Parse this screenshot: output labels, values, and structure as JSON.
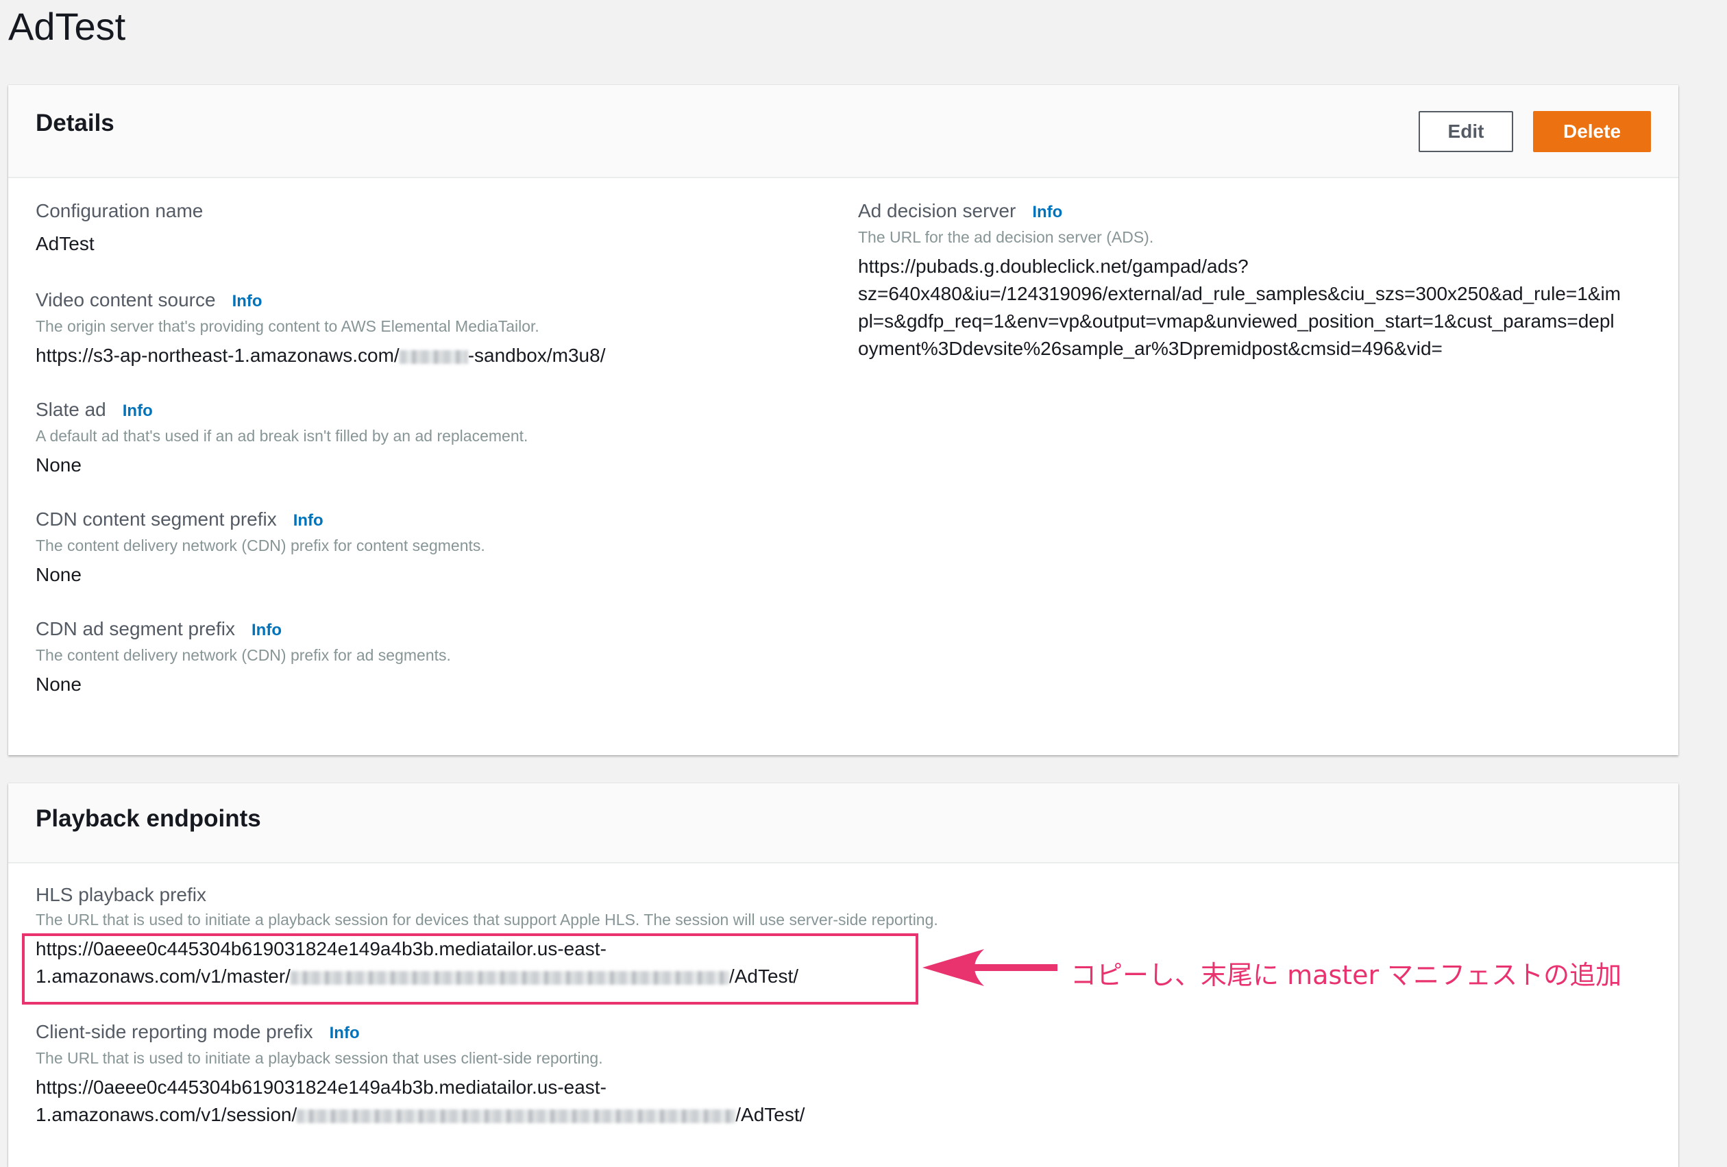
{
  "page": {
    "title": "AdTest"
  },
  "details": {
    "title": "Details",
    "edit_label": "Edit",
    "delete_label": "Delete",
    "info_label": "Info",
    "config_name": {
      "label": "Configuration name",
      "value": "AdTest"
    },
    "video_source": {
      "label": "Video content source",
      "desc": "The origin server that's providing content to AWS Elemental MediaTailor.",
      "value_prefix": "https://s3-ap-northeast-1.amazonaws.com/",
      "value_suffix": "-sandbox/m3u8/"
    },
    "slate_ad": {
      "label": "Slate ad",
      "desc": "A default ad that's used if an ad break isn't filled by an ad replacement.",
      "value": "None"
    },
    "cdn_content": {
      "label": "CDN content segment prefix",
      "desc": "The content delivery network (CDN) prefix for content segments.",
      "value": "None"
    },
    "cdn_ad": {
      "label": "CDN ad segment prefix",
      "desc": "The content delivery network (CDN) prefix for ad segments.",
      "value": "None"
    },
    "ads": {
      "label": "Ad decision server",
      "desc": "The URL for the ad decision server (ADS).",
      "line1": "https://pubads.g.doubleclick.net/gampad/ads?",
      "line2": "sz=640x480&iu=/124319096/external/ad_rule_samples&ciu_szs=300x250&ad_rule=1&im",
      "line3": "pl=s&gdfp_req=1&env=vp&output=vmap&unviewed_position_start=1&cust_params=depl",
      "line4": "oyment%3Ddevsite%26sample_ar%3Dpremidpost&cmsid=496&vid="
    }
  },
  "playback": {
    "title": "Playback endpoints",
    "hls": {
      "label": "HLS playback prefix",
      "desc": "The URL that is used to initiate a playback session for devices that support Apple HLS. The session will use server-side reporting.",
      "line1": "https://0aeee0c445304b619031824e149a4b3b.mediatailor.us-east-",
      "line2_prefix": "1.amazonaws.com/v1/master/",
      "line2_suffix": "/AdTest/"
    },
    "client_side": {
      "label": "Client-side reporting mode prefix",
      "desc": "The URL that is used to initiate a playback session that uses client-side reporting.",
      "line1": "https://0aeee0c445304b619031824e149a4b3b.mediatailor.us-east-",
      "line2_prefix": "1.amazonaws.com/v1/session/",
      "line2_suffix": "/AdTest/"
    }
  },
  "annotation": {
    "text": "コピーし、末尾に master マニフェストの追加",
    "color": "#e8336e"
  }
}
